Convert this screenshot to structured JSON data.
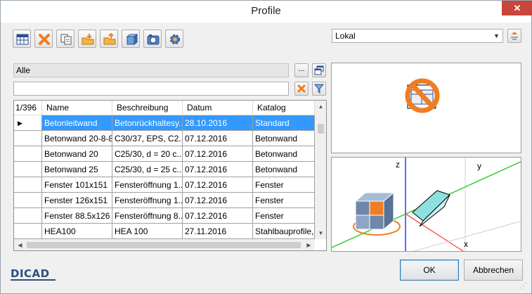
{
  "window": {
    "title": "Profile",
    "close_glyph": "✕"
  },
  "toolbar": {
    "buttons": [
      {
        "icon": "table-icon"
      },
      {
        "icon": "delete-icon"
      },
      {
        "icon": "copy-icon"
      },
      {
        "icon": "import-folder-icon"
      },
      {
        "icon": "export-folder-icon"
      },
      {
        "icon": "dimension-icon"
      },
      {
        "icon": "camera-icon"
      },
      {
        "icon": "settings-icon"
      }
    ]
  },
  "location_select": {
    "value": "Lokal"
  },
  "filter": {
    "category_value": "Alle",
    "more_button": "...",
    "search_value": ""
  },
  "grid": {
    "counter": "1/396",
    "columns": [
      "Name",
      "Beschreibung",
      "Datum",
      "Katalog"
    ],
    "rows": [
      {
        "name": "Betonleitwand",
        "desc": "Betonrückhaltesy...",
        "date": "28.10.2016",
        "catalog": "Standard",
        "selected": true
      },
      {
        "name": "Betonwand 20-8-8",
        "desc": "C30/37, EPS, C2...",
        "date": "07.12.2016",
        "catalog": "Betonwand"
      },
      {
        "name": "Betonwand 20",
        "desc": "C25/30, d = 20 c...",
        "date": "07.12.2016",
        "catalog": "Betonwand"
      },
      {
        "name": "Betonwand 25",
        "desc": "C25/30, d = 25 c...",
        "date": "07.12.2016",
        "catalog": "Betonwand"
      },
      {
        "name": "Fenster 101x151",
        "desc": "Fensteröffnung 1...",
        "date": "07.12.2016",
        "catalog": "Fenster"
      },
      {
        "name": "Fenster 126x151",
        "desc": "Fensteröffnung 1...",
        "date": "07.12.2016",
        "catalog": "Fenster"
      },
      {
        "name": "Fenster 88.5x126",
        "desc": "Fensteröffnung 8...",
        "date": "07.12.2016",
        "catalog": "Fenster"
      },
      {
        "name": "HEA100",
        "desc": "HEA 100",
        "date": "27.11.2016",
        "catalog": "Stahlbauprofile,H..."
      }
    ]
  },
  "view3d": {
    "axis_z": "z",
    "axis_y": "y",
    "axis_x": "x"
  },
  "buttons": {
    "ok": "OK",
    "cancel": "Abbrechen"
  },
  "brand": {
    "logo_text": "DICAD"
  },
  "colors": {
    "selection": "#3399ff",
    "close": "#c7473a",
    "accent_orange": "#f07d24"
  }
}
